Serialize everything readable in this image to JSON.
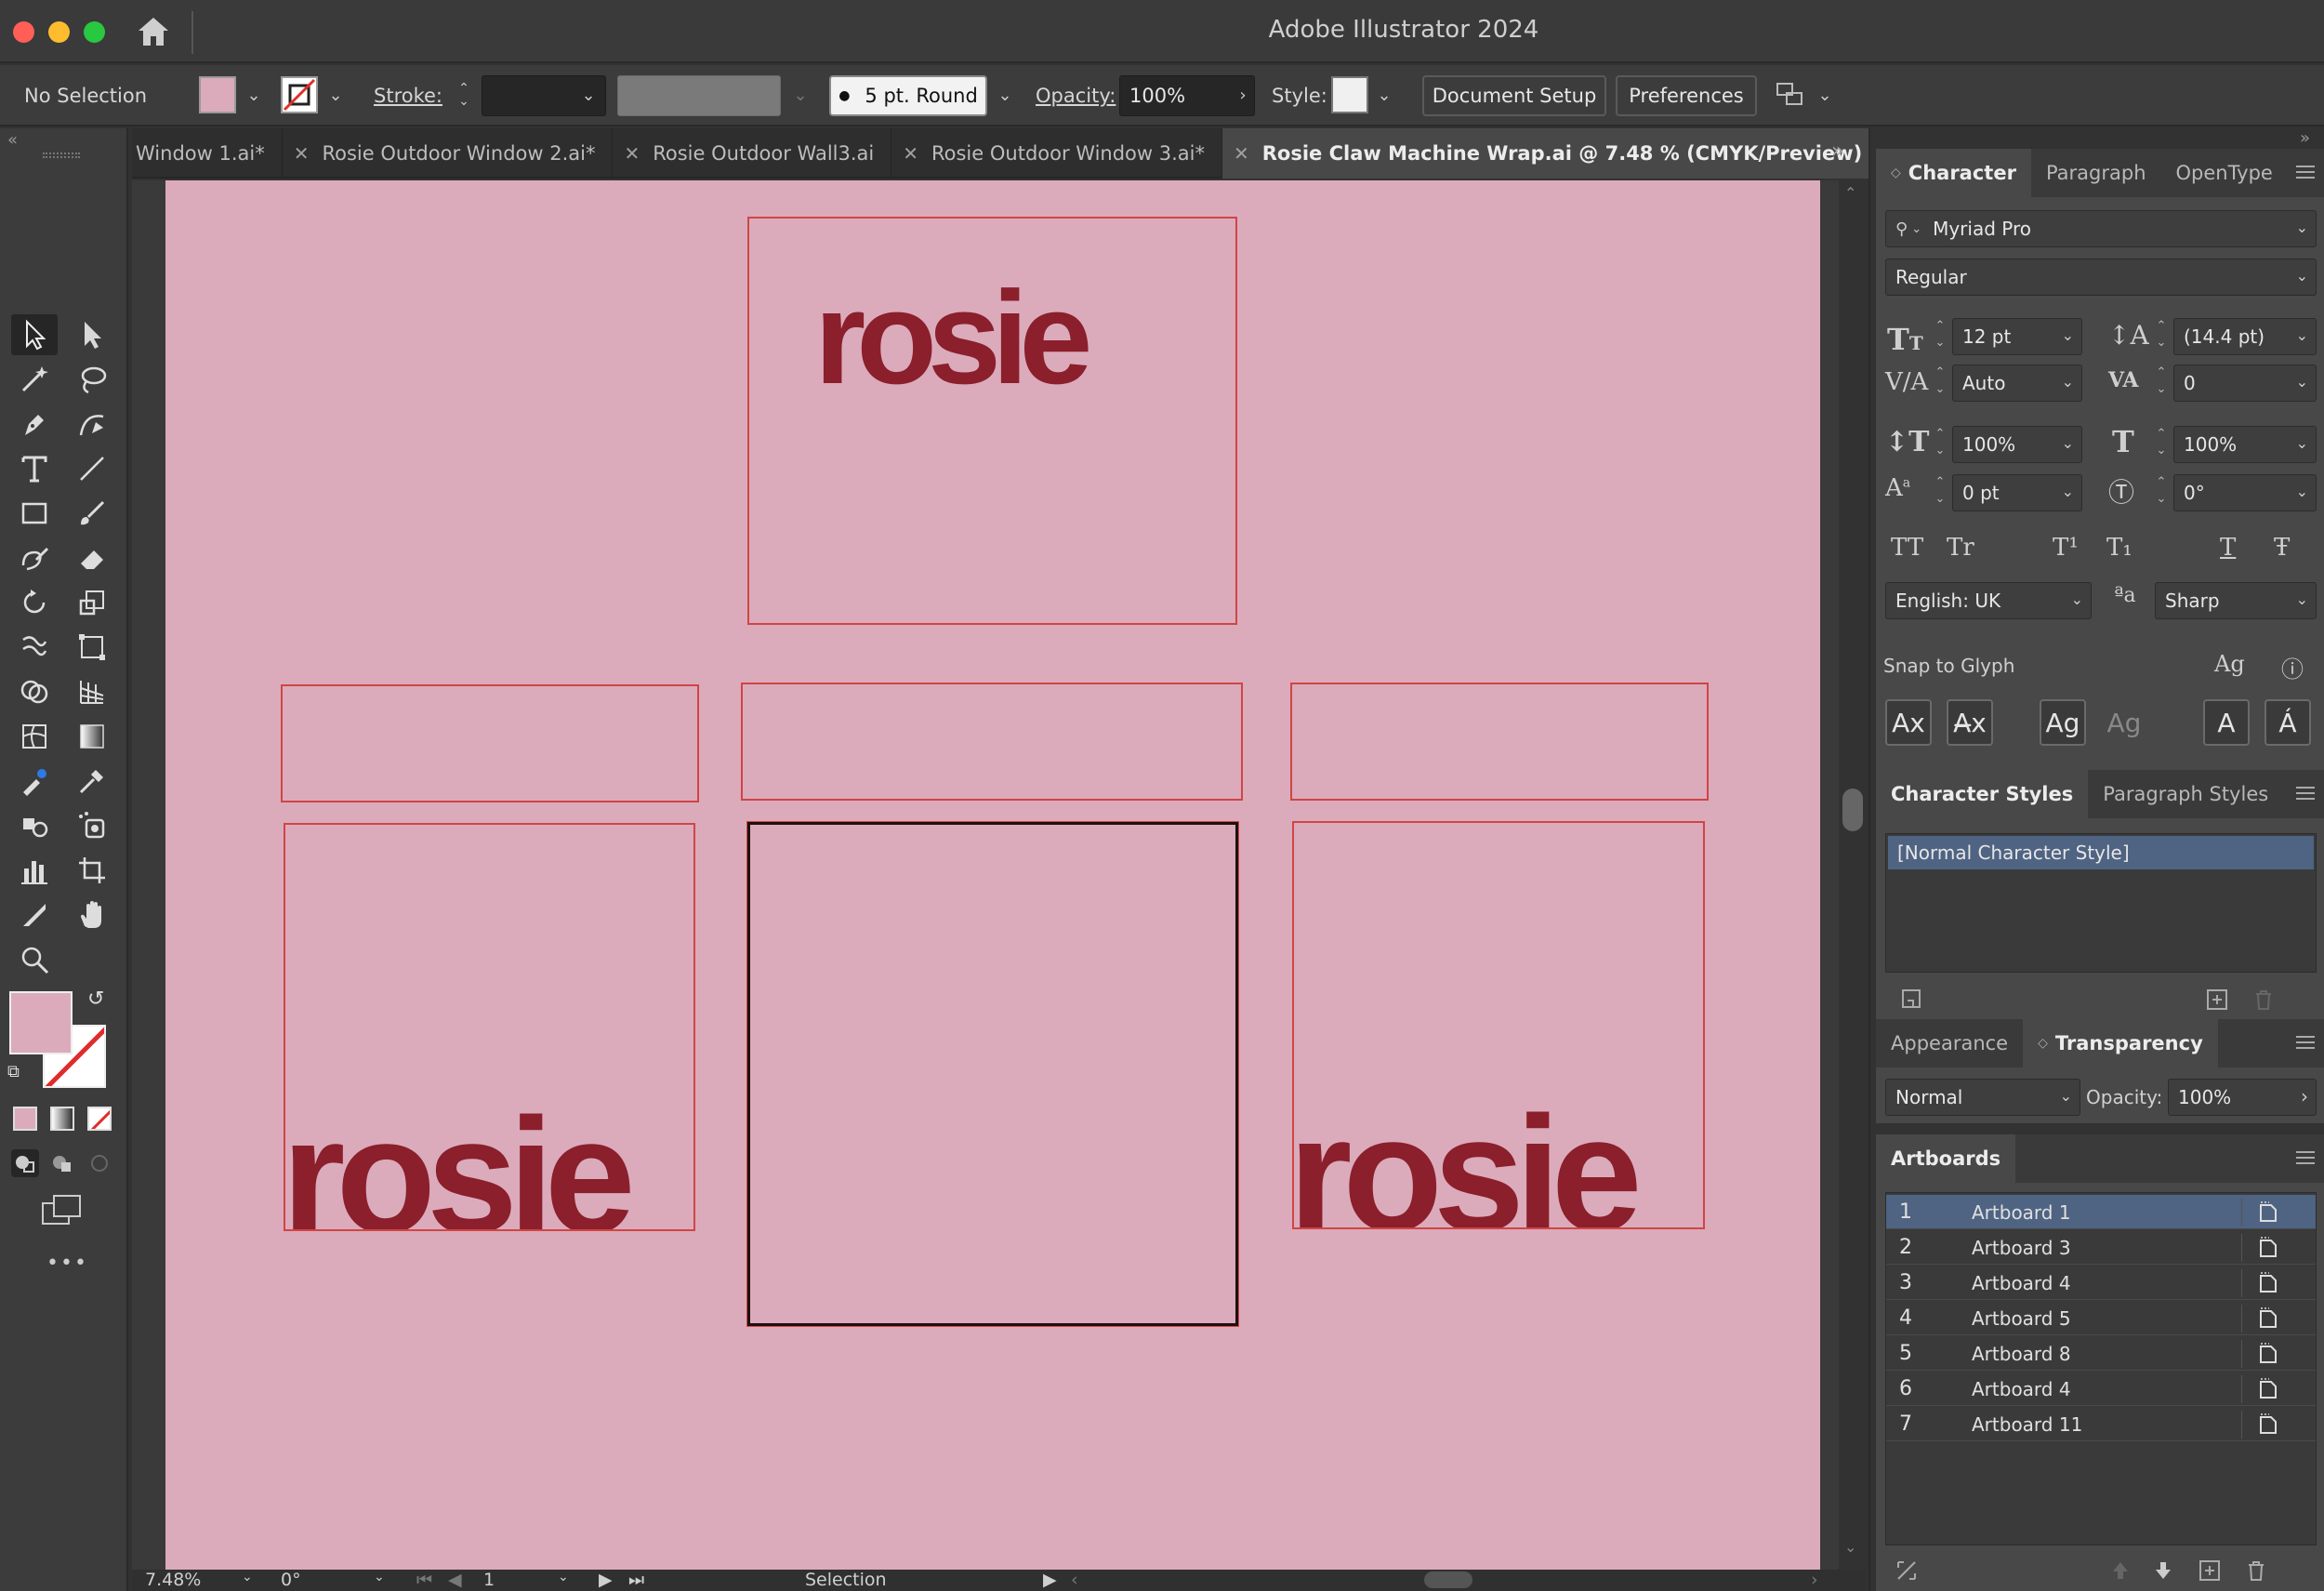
{
  "app": {
    "title": "Adobe Illustrator 2024"
  },
  "control_bar": {
    "selection_label": "No Selection",
    "fill_color": "#dbabbb",
    "stroke_label": "Stroke:",
    "brush_label": "5 pt. Round",
    "opacity_label": "Opacity:",
    "opacity_value": "100%",
    "style_label": "Style:",
    "document_setup": "Document Setup",
    "preferences": "Preferences"
  },
  "tabs": [
    {
      "label": "Window 1.ai*",
      "active": false
    },
    {
      "label": "Rosie Outdoor Window 2.ai*",
      "active": false
    },
    {
      "label": "Rosie Outdoor Wall3.ai",
      "active": false
    },
    {
      "label": "Rosie Outdoor Window 3.ai*",
      "active": false
    },
    {
      "label": "Rosie Claw Machine Wrap.ai @ 7.48 % (CMYK/Preview)",
      "active": true
    }
  ],
  "canvas": {
    "background": "#dbabbb",
    "logo_text": "rosie",
    "logo_color": "#8b1f2c",
    "artboard_border": "#d04545"
  },
  "status_bar": {
    "zoom": "7.48%",
    "rotation": "0°",
    "artboard_number": "1",
    "tool": "Selection"
  },
  "character_panel": {
    "tabs": [
      "Character",
      "Paragraph",
      "OpenType"
    ],
    "font_family": "Myriad Pro",
    "font_style": "Regular",
    "font_size": "12 pt",
    "leading": "(14.4 pt)",
    "kerning": "Auto",
    "tracking": "0",
    "vertical_scale": "100%",
    "horizontal_scale": "100%",
    "baseline_shift": "0 pt",
    "rotation": "0°",
    "case_buttons": [
      "TT",
      "Tr",
      "T¹",
      "T₁",
      "T",
      "Ŧ"
    ],
    "language": "English: UK",
    "anti_alias_icon": "ªa",
    "anti_alias": "Sharp",
    "snap_label": "Snap to Glyph",
    "snap_buttons": [
      "Ax",
      "A̶x",
      "Ag",
      "Ag",
      "A",
      "Á"
    ]
  },
  "char_styles_panel": {
    "tabs": [
      "Character Styles",
      "Paragraph Styles"
    ],
    "items": [
      "[Normal Character Style]"
    ]
  },
  "transparency_panel": {
    "tabs": [
      "Appearance",
      "Transparency"
    ],
    "blend_mode": "Normal",
    "opacity_label": "Opacity:",
    "opacity_value": "100%"
  },
  "artboards_panel": {
    "tab": "Artboards",
    "rows": [
      {
        "num": "1",
        "name": "Artboard 1"
      },
      {
        "num": "2",
        "name": "Artboard 3"
      },
      {
        "num": "3",
        "name": "Artboard 4"
      },
      {
        "num": "4",
        "name": "Artboard 5"
      },
      {
        "num": "5",
        "name": "Artboard 8"
      },
      {
        "num": "6",
        "name": "Artboard 4"
      },
      {
        "num": "7",
        "name": "Artboard 11"
      }
    ]
  },
  "toolbar": {
    "more_label": "•••"
  }
}
